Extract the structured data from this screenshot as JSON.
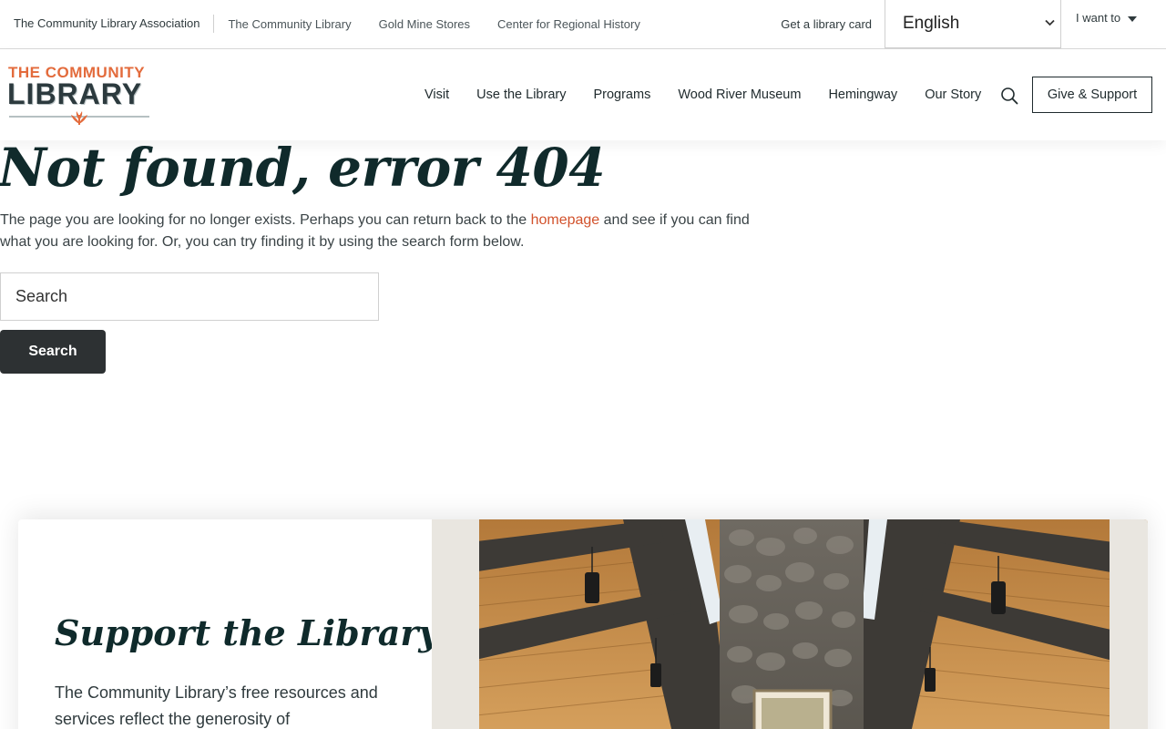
{
  "utility": {
    "links": [
      "The Community Library Association",
      "The Community Library",
      "Gold Mine Stores",
      "Center for Regional History"
    ],
    "card_link": "Get a library card",
    "language": "English",
    "i_want_to": "I want to"
  },
  "logo": {
    "line1": "THE COMMUNITY",
    "line2": "LIBRARY"
  },
  "nav": {
    "items": [
      "Visit",
      "Use the Library",
      "Programs",
      "Wood River Museum",
      "Hemingway",
      "Our Story"
    ],
    "give_label": "Give & Support"
  },
  "error": {
    "title": "Not found, error 404",
    "text_before": "The page you are looking for no longer exists. Perhaps you can return back to the ",
    "link": "homepage",
    "text_after": " and see if you can find what you are looking for. Or, you can try finding it by using the search form below.",
    "search_placeholder": "Search",
    "search_button": "Search"
  },
  "support": {
    "title": "Support the Library",
    "text": "The Community Library’s free resources and services reflect the generosity of"
  },
  "colors": {
    "accent": "#d2522c",
    "logo_orange": "#e36b3c",
    "dark": "#102a2b",
    "button": "#2d3133"
  }
}
